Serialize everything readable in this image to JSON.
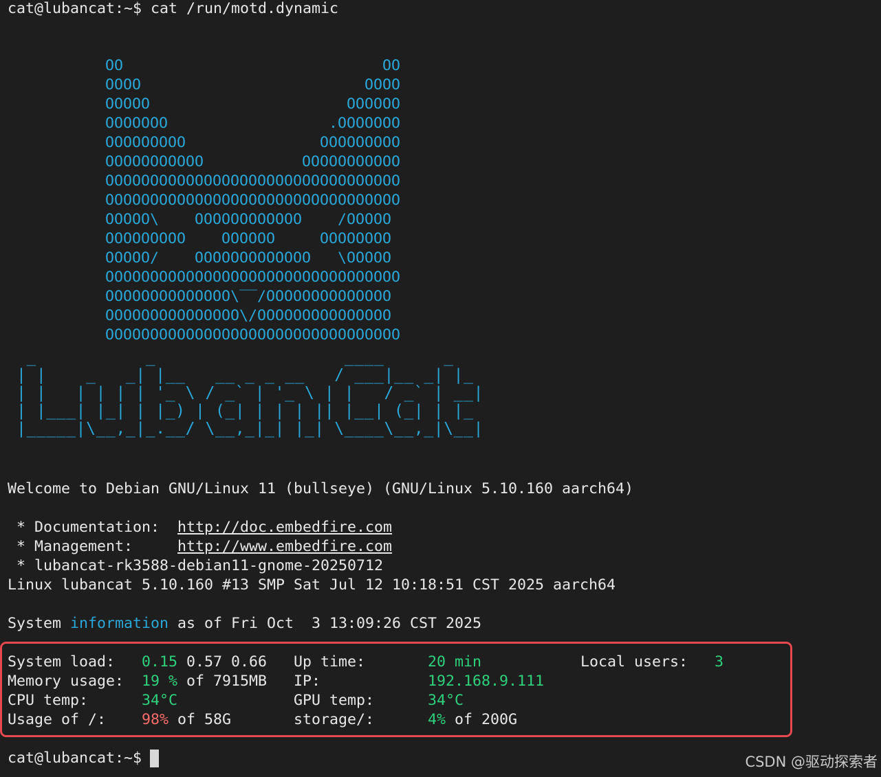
{
  "command": {
    "prompt": "cat@lubancat:~$",
    "text": " cat /run/motd.dynamic"
  },
  "ascii_cat": [
    "OO                             OO",
    "OOOO                         OOOO",
    "OOOOO                      OOOOOO",
    "OOOOOOO                  .OOOOOOO",
    "OOOOOOOOO               OOOOOOOOO",
    "OOOOOOOOOOO           OOOOOOOOOOO",
    "OOOOOOOOOOOOOOOOOOOOOOOOOOOOOOOOO",
    "OOOOOOOOOOOOOOOOOOOOOOOOOOOOOOOOO",
    "OOOOO\\    OOOOOOOOOOOO    /OOOOO",
    "OOOOOOOOO    OOOOOO     OOOOOOOO",
    "OOOOO/    OOOOOOOOOOOOO   \\OOOOO",
    "OOOOOOOOOOOOOOOOOOOOOOOOOOOOOOOOO",
    "OOOOOOOOOOOOOO\\‾‾/OOOOOOOOOOOOOO",
    "OOOOOOOOOOOOOOO\\/OOOOOOOOOOOOOOO",
    "OOOOOOOOOOOOOOOOOOOOOOOOOOOOOOOOO"
  ],
  "ascii_logo": [
    " _           _                   ____      _   ",
    "| |    _   _| |__   __ _ _ __   / ___|__ _| |_ ",
    "| |   | | | | '_ \\ / _` | '_ \\ | |   / _` | __|",
    "| |___| |_| | |_) | (_| | | | || |__| (_| | |_ ",
    "|_____|\\__,_|_.__/ \\__,_|_| |_| \\____\\__,_|\\__|"
  ],
  "welcome": "Welcome to Debian GNU/Linux 11 (bullseye) (GNU/Linux 5.10.160 aarch64)",
  "info_lines": {
    "doc_label": " * Documentation:  ",
    "doc_url": "http://doc.embedfire.com",
    "mgmt_label": " * Management:     ",
    "mgmt_url": "http://www.embedfire.com",
    "image_line": " * lubancat-rk3588-debian11-gnome-20250712",
    "kernel_line": "Linux lubancat 5.10.160 #13 SMP Sat Jul 12 10:18:51 CST 2025 aarch64"
  },
  "sysinfo_header": {
    "prefix": "System ",
    "highlight": "information",
    "suffix": " as of Fri Oct  3 13:09:26 CST 2025"
  },
  "sysinfo": {
    "load_label": "System load:",
    "load_1": "0.15",
    "load_rest": " 0.57 0.66",
    "uptime_label": "Up time:",
    "uptime_value": "20 min",
    "users_label": "Local users:",
    "users_value": "3",
    "mem_label": "Memory usage:",
    "mem_pct": "19 %",
    "mem_rest": " of 7915MB",
    "ip_label": "IP:",
    "ip_value": "192.168.9.111",
    "cpu_label": "CPU temp:",
    "cpu_value": "34°C",
    "gpu_label": "GPU temp:",
    "gpu_value": "34°C",
    "usage_label": "Usage of /:",
    "usage_pct": "98%",
    "usage_rest": " of 58G",
    "storage_label": "storage/:",
    "storage_pct": "4%",
    "storage_rest": " of 200G"
  },
  "final_prompt": "cat@lubancat:~$",
  "watermark": "CSDN @驱动探索者",
  "colors": {
    "background": "#1e1e1e",
    "foreground": "#e8e8e8",
    "cyan": "#2aa7d8",
    "green": "#2ed17c",
    "red": "#ff6b6b",
    "highlight_box": "#e5484d"
  }
}
